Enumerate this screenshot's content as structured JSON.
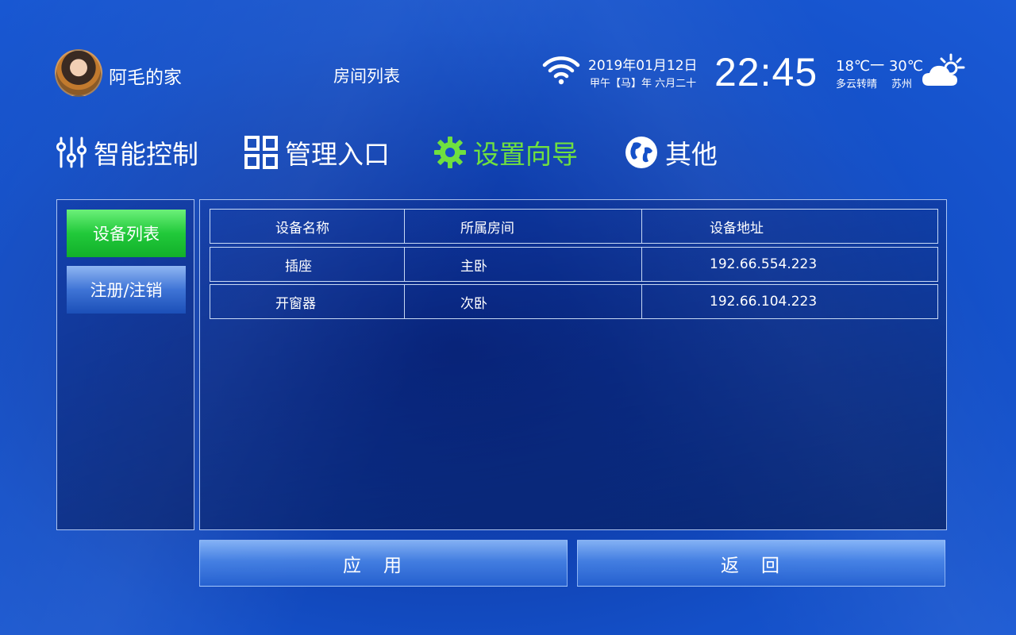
{
  "header": {
    "home_name": "阿毛的家",
    "page_title": "房间列表",
    "date": "2019年01月12日",
    "lunar": "甲午【马】年 六月二十",
    "time": "22:45",
    "temperature": "18℃一 30℃",
    "weather": "多云转晴",
    "city": "苏州"
  },
  "nav": {
    "items": [
      {
        "label": "智能控制",
        "icon": "sliders-icon"
      },
      {
        "label": "管理入口",
        "icon": "grid-icon"
      },
      {
        "label": "设置向导",
        "icon": "gear-icon",
        "active": true
      },
      {
        "label": "其他",
        "icon": "globe-icon"
      }
    ],
    "active_color": "#6fe03f"
  },
  "sidebar": {
    "items": [
      {
        "label": "设备列表",
        "active": true
      },
      {
        "label": "注册/注销",
        "active": false
      }
    ]
  },
  "table": {
    "headers": [
      "设备名称",
      "所属房间",
      "设备地址"
    ],
    "rows": [
      [
        "插座",
        "主卧",
        "192.66.554.223"
      ],
      [
        "开窗器",
        "次卧",
        "192.66.104.223"
      ]
    ]
  },
  "buttons": {
    "apply": "应用",
    "back": "返回"
  }
}
